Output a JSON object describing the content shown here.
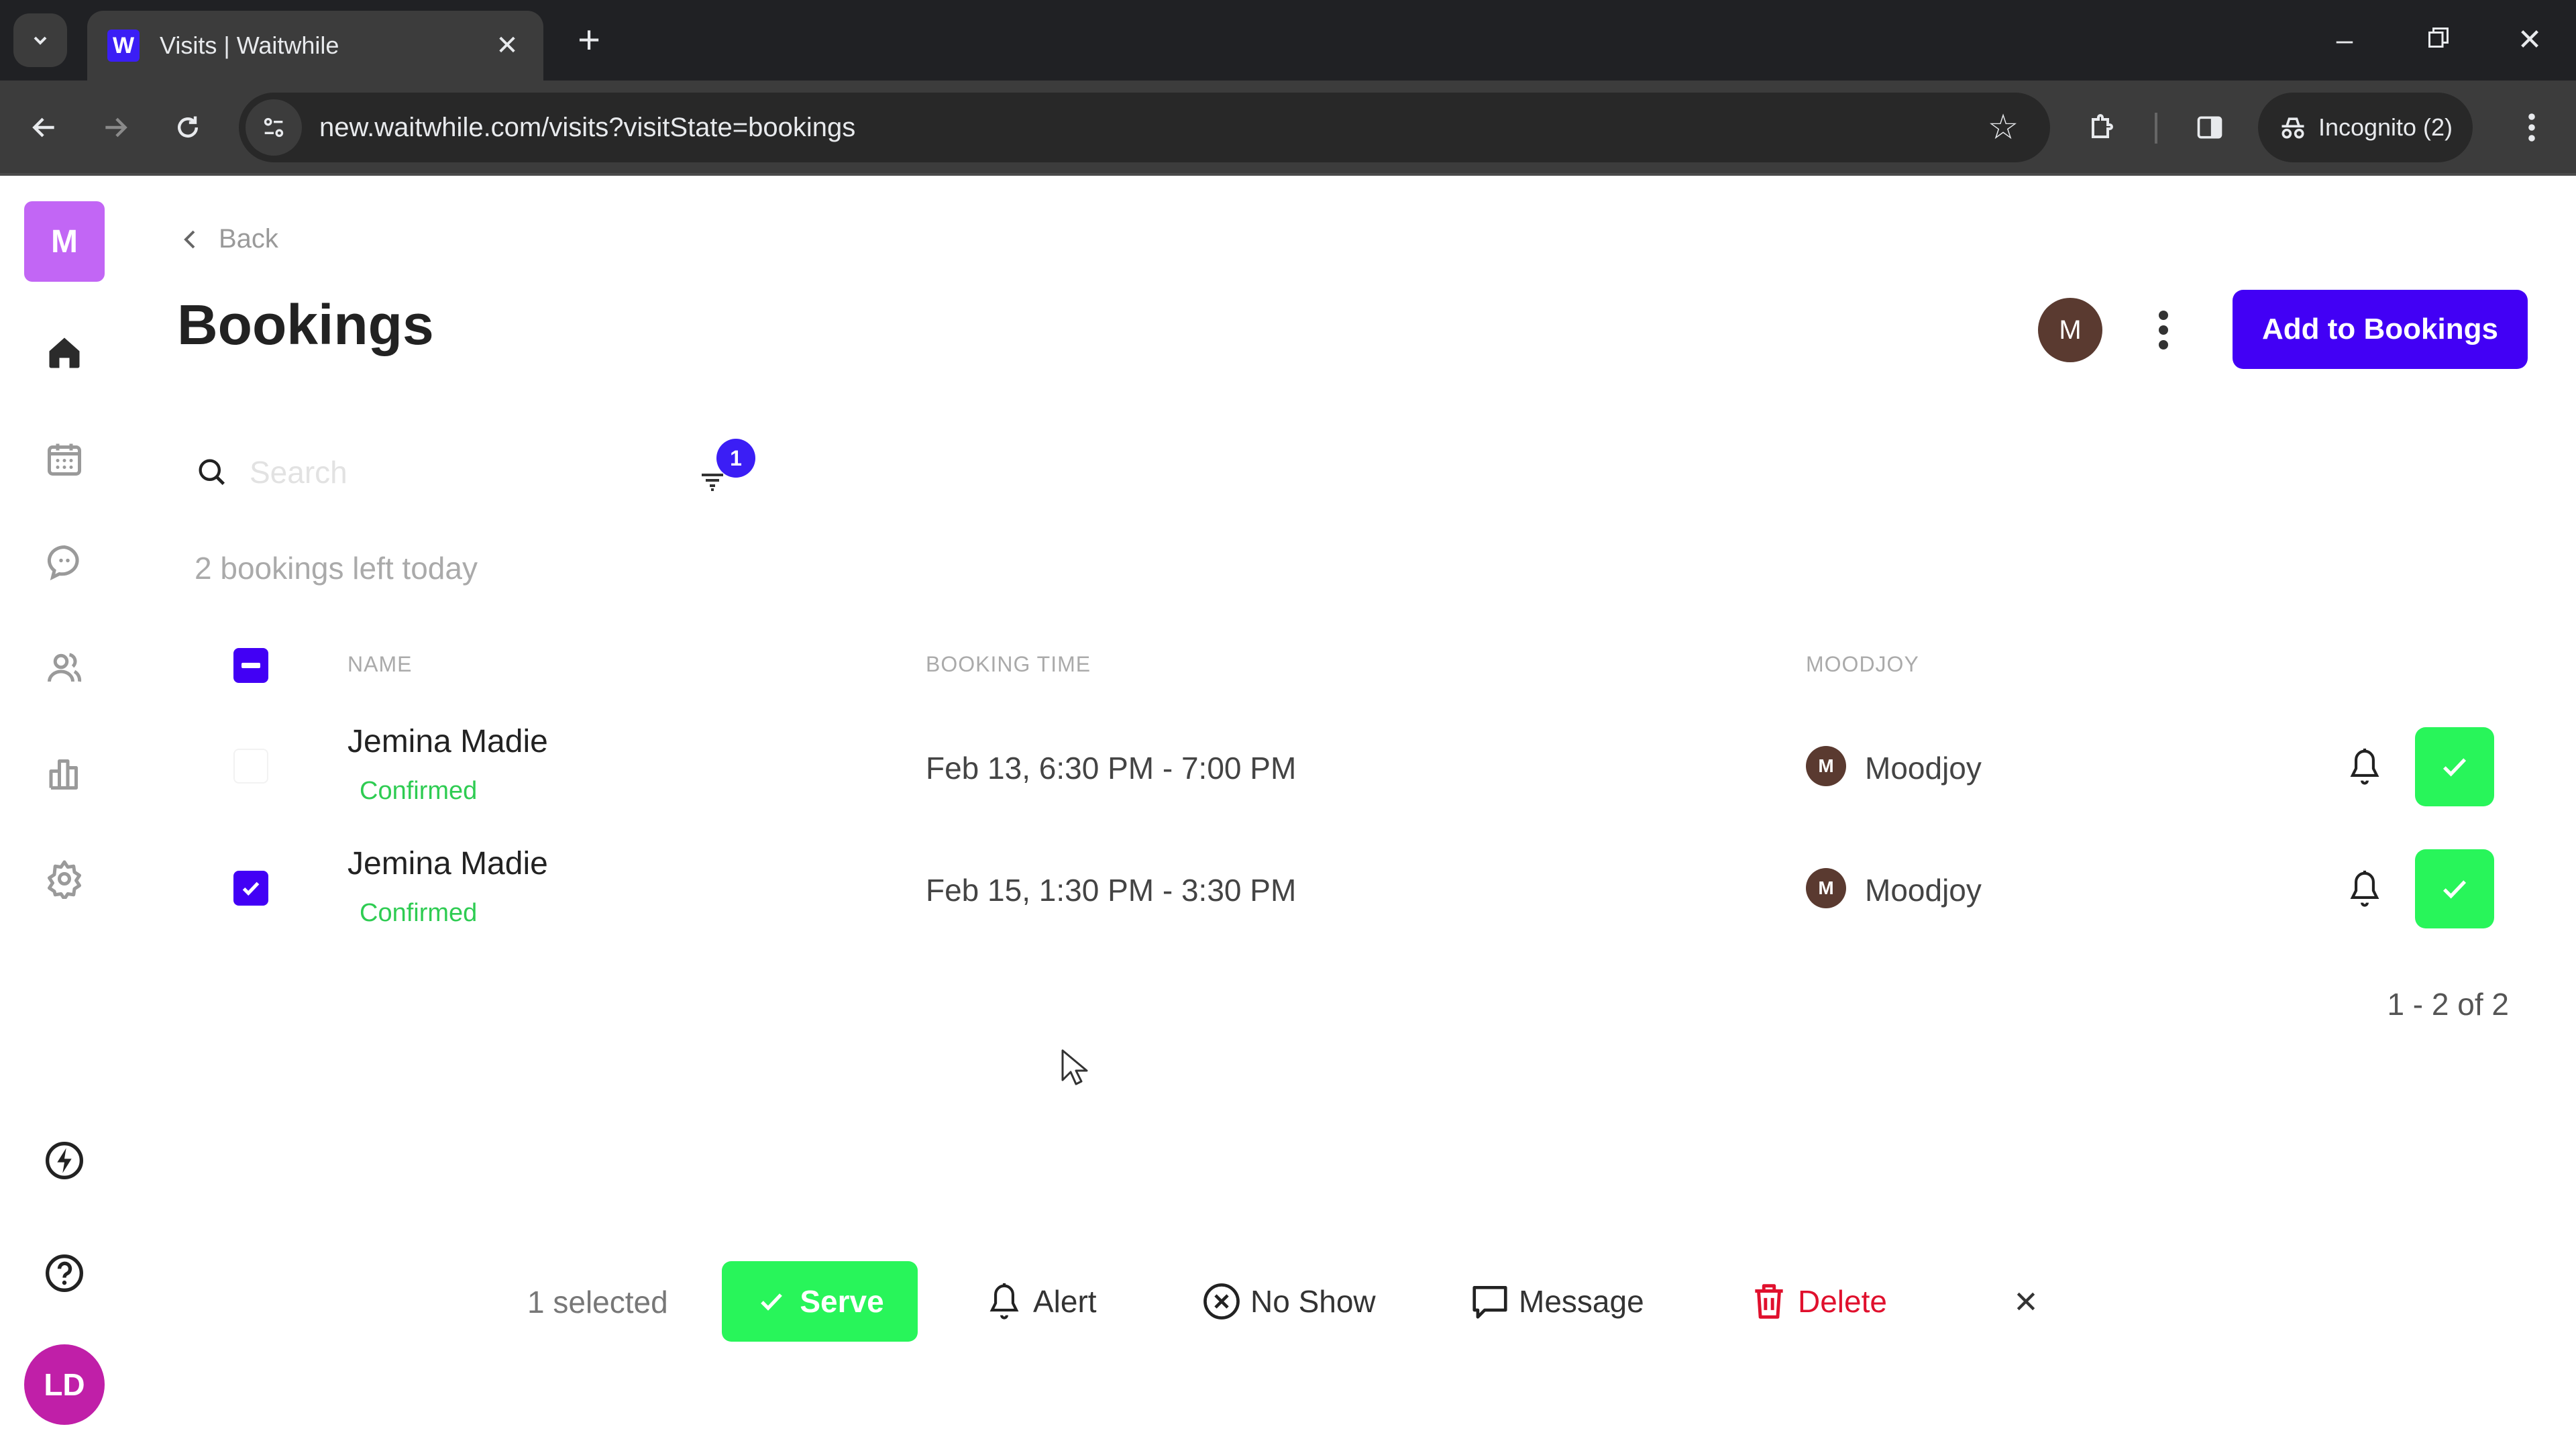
{
  "browser": {
    "tab_title": "Visits | Waitwhile",
    "tab_favicon_letter": "W",
    "url": "new.waitwhile.com/visits?visitState=bookings",
    "incognito_label": "Incognito (2)"
  },
  "sidebar": {
    "org_initial": "M",
    "org_color": "#c266f5",
    "items": [
      {
        "icon": "home-icon",
        "label": "Home",
        "active": true
      },
      {
        "icon": "calendar-icon",
        "label": "Calendar"
      },
      {
        "icon": "chat-icon",
        "label": "Messages"
      },
      {
        "icon": "users-icon",
        "label": "Customers"
      },
      {
        "icon": "analytics-icon",
        "label": "Analytics"
      },
      {
        "icon": "gear-icon",
        "label": "Settings"
      }
    ],
    "bottom_items": [
      {
        "icon": "lightning-icon",
        "label": "Updates"
      },
      {
        "icon": "help-icon",
        "label": "Help"
      }
    ],
    "user_initials": "LD",
    "user_color": "#c01fa8"
  },
  "header": {
    "back_label": "Back",
    "title": "Bookings",
    "location_avatar_initial": "M",
    "add_button_label": "Add to Bookings",
    "accent_color": "#4200f5"
  },
  "search": {
    "placeholder": "Search",
    "value": "",
    "filter_count": "1"
  },
  "summary": "2 bookings left today",
  "table": {
    "columns": [
      "NAME",
      "BOOKING TIME",
      "MOODJOY"
    ],
    "select_all_state": "indeterminate",
    "rows": [
      {
        "name": "Jemina Madie",
        "status": "Confirmed",
        "booking_time": "Feb 13, 6:30 PM - 7:00 PM",
        "location_initial": "M",
        "location": "Moodjoy",
        "selected": false
      },
      {
        "name": "Jemina Madie",
        "status": "Confirmed",
        "booking_time": "Feb 15, 1:30 PM - 3:30 PM",
        "location_initial": "M",
        "location": "Moodjoy",
        "selected": true
      }
    ],
    "pagination": "1 - 2 of 2"
  },
  "bulk_actions": {
    "selected_count": "1 selected",
    "serve": "Serve",
    "alert": "Alert",
    "no_show": "No Show",
    "message": "Message",
    "delete": "Delete",
    "serve_color": "#28f55a",
    "delete_color": "#e0102d"
  }
}
